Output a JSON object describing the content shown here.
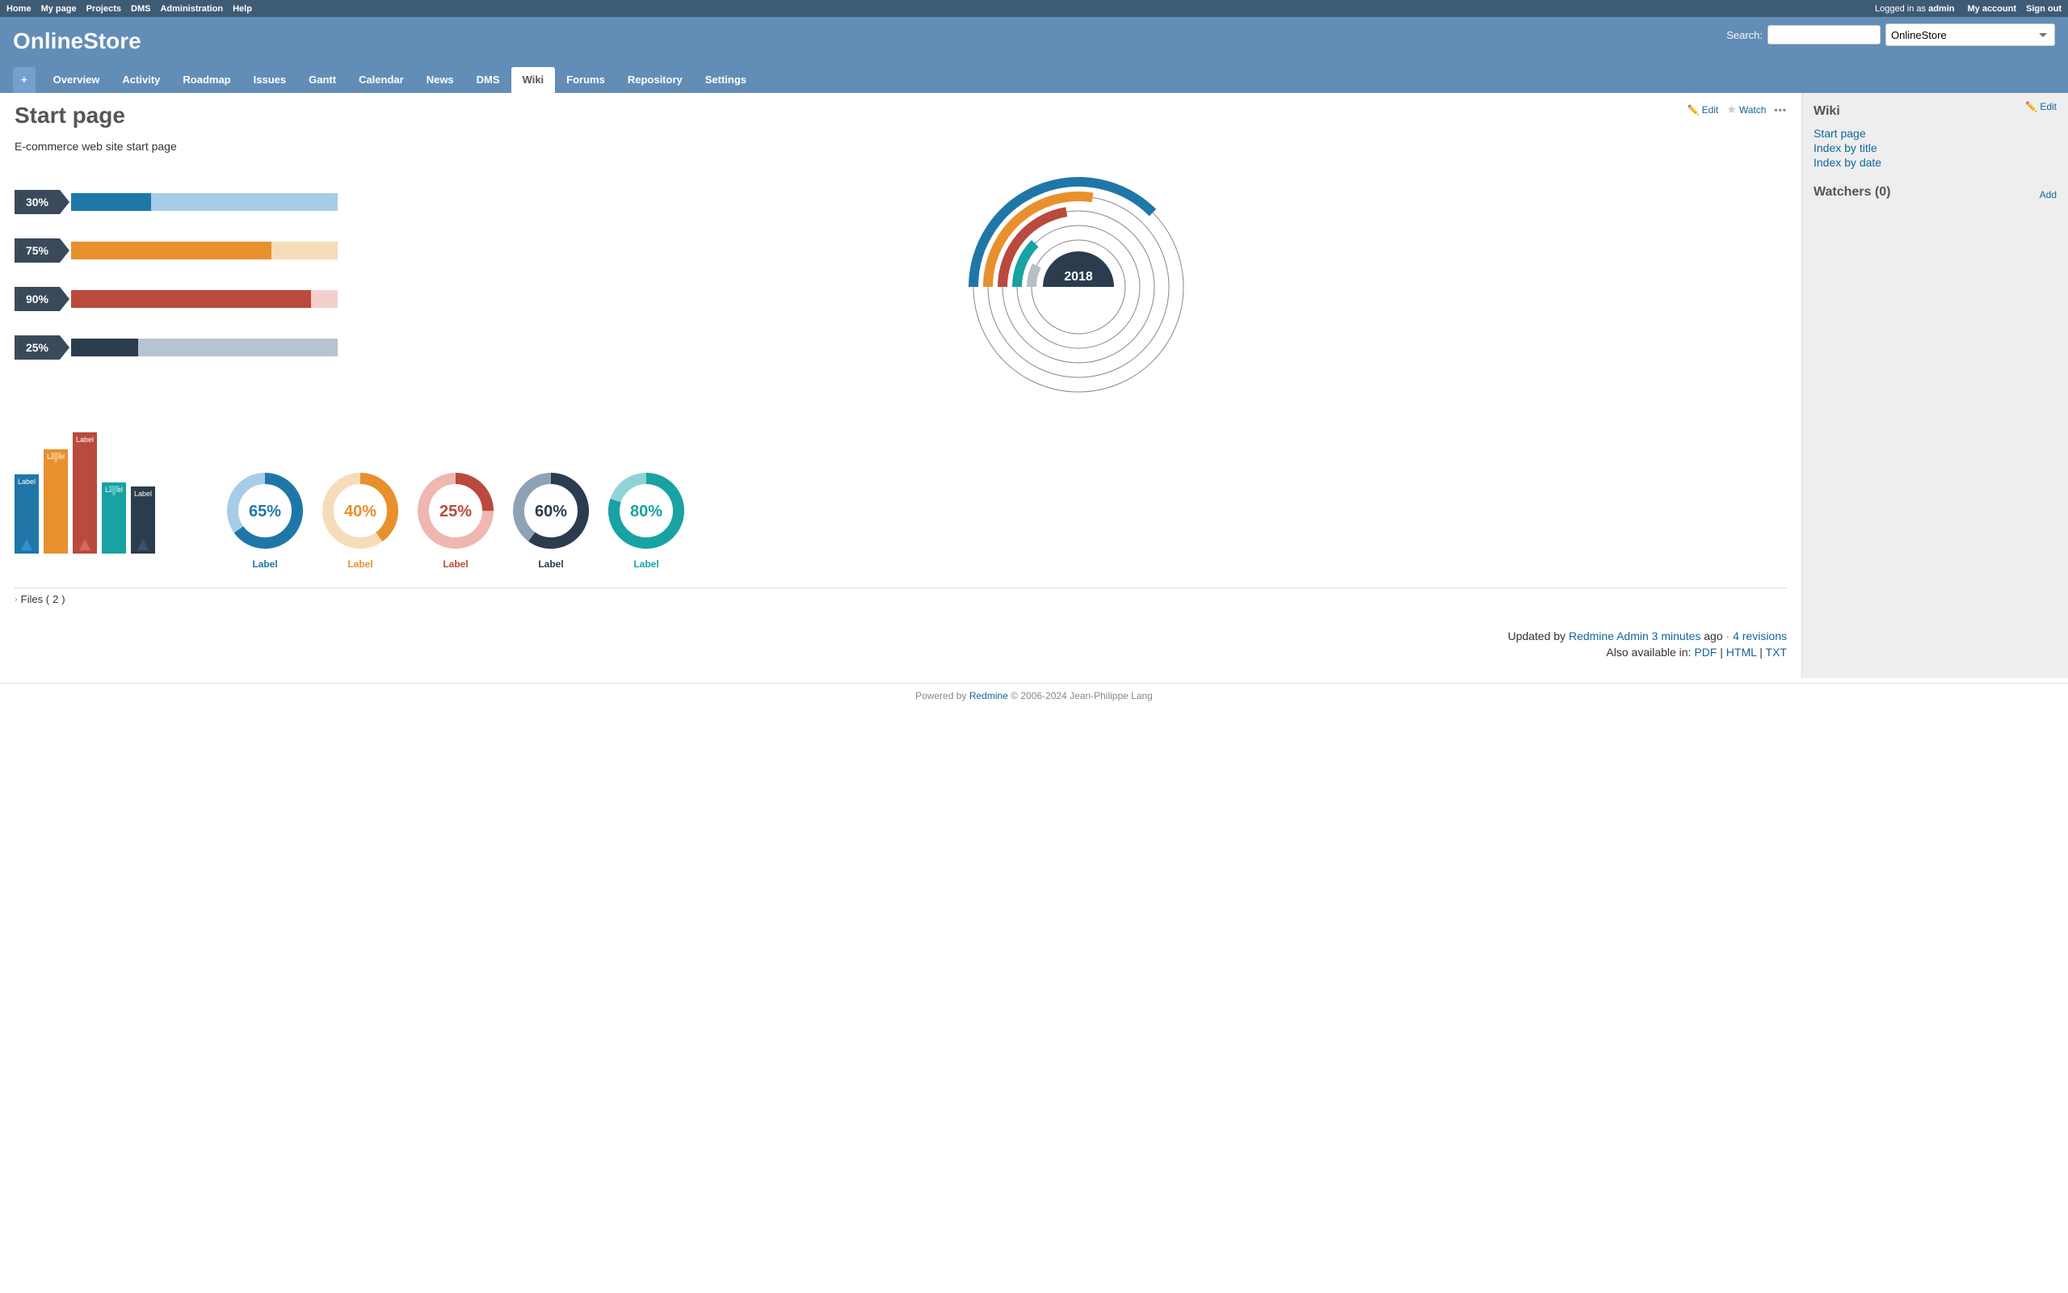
{
  "top_menu": {
    "left": [
      "Home",
      "My page",
      "Projects",
      "DMS",
      "Administration",
      "Help"
    ],
    "logged_as_prefix": "Logged in as ",
    "logged_user": "admin",
    "right": [
      "My account",
      "Sign out"
    ]
  },
  "header": {
    "project_title": "OnlineStore",
    "search_label": "Search:",
    "project_select": "OnlineStore"
  },
  "main_menu": {
    "new_object": "+",
    "tabs": [
      "Overview",
      "Activity",
      "Roadmap",
      "Issues",
      "Gantt",
      "Calendar",
      "News",
      "DMS",
      "Wiki",
      "Forums",
      "Repository",
      "Settings"
    ],
    "active": "Wiki"
  },
  "contextual": {
    "edit": "Edit",
    "watch": "Watch",
    "more": "•••"
  },
  "page": {
    "title": "Start page",
    "desc": "E-commerce web site start page"
  },
  "chart_data": [
    {
      "type": "bar",
      "orientation": "horizontal",
      "title": "",
      "series": [
        {
          "label": "30%",
          "value": 30,
          "fill": "#1f77a8",
          "track": "#a7cce8"
        },
        {
          "label": "75%",
          "value": 75,
          "fill": "#e8902e",
          "track": "#f7dcb9"
        },
        {
          "label": "90%",
          "value": 90,
          "fill": "#b94a3d",
          "track": "#f4d0cd"
        },
        {
          "label": "25%",
          "value": 25,
          "fill": "#2b3c4e",
          "track": "#b7c3d0"
        }
      ],
      "xlim": [
        0,
        100
      ]
    },
    {
      "type": "radial",
      "center_label": "2018",
      "rings": [
        {
          "color": "#1f77a8",
          "value": 75
        },
        {
          "color": "#e8902e",
          "value": 55
        },
        {
          "color": "#b94a3d",
          "value": 45
        },
        {
          "color": "#18a2a2",
          "value": 25
        },
        {
          "color": "#b7bfc6",
          "value": 15
        }
      ]
    },
    {
      "type": "bar",
      "orientation": "vertical",
      "categories": [
        "Label",
        "Label",
        "Label",
        "Label",
        "Label"
      ],
      "series": [
        {
          "value": 95,
          "color": "#1f77a8",
          "arrow": "up",
          "arrow_color": "#2e94d1"
        },
        {
          "value": 125,
          "color": "#e8902e",
          "arrow": "down",
          "arrow_color": "#f2b567"
        },
        {
          "value": 145,
          "color": "#b94a3d",
          "arrow": "up",
          "arrow_color": "#d36a5e"
        },
        {
          "value": 85,
          "color": "#18a2a2",
          "arrow": "down",
          "arrow_color": "#4cc2c2"
        },
        {
          "value": 80,
          "color": "#2b3c4e",
          "arrow": "up",
          "arrow_color": "#3d5268"
        }
      ]
    },
    {
      "type": "donut-multiples",
      "items": [
        {
          "pct": 65,
          "label": "Label",
          "color": "#1f77a8",
          "track": "#a7cce8"
        },
        {
          "pct": 40,
          "label": "Label",
          "color": "#e8902e",
          "track": "#f7dcb9"
        },
        {
          "pct": 25,
          "label": "Label",
          "color": "#b94a3d",
          "track": "#f0b6b0"
        },
        {
          "pct": 60,
          "label": "Label",
          "color": "#2b3c4e",
          "track": "#8ea2b5"
        },
        {
          "pct": 80,
          "label": "Label",
          "color": "#18a2a2",
          "track": "#8fd4d4"
        }
      ]
    }
  ],
  "files": {
    "label_prefix": "Files (",
    "count": 2,
    "label_suffix": ")"
  },
  "update_info": {
    "updated_by_prefix": "Updated by ",
    "author": "Redmine Admin",
    "time_link": "3 minutes",
    "time_suffix": " ago",
    "sep": " · ",
    "revisions": "4 revisions"
  },
  "export": {
    "prefix": "Also available in: ",
    "formats": [
      "PDF",
      "HTML",
      "TXT"
    ],
    "sep": " | "
  },
  "sidebar": {
    "edit": "Edit",
    "wiki_heading": "Wiki",
    "links": [
      "Start page",
      "Index by title",
      "Index by date"
    ],
    "watchers_heading": "Watchers (0)",
    "add": "Add"
  },
  "footer": {
    "powered": "Powered by ",
    "redmine": "Redmine",
    "copyright": " © 2006-2024 Jean-Philippe Lang"
  }
}
